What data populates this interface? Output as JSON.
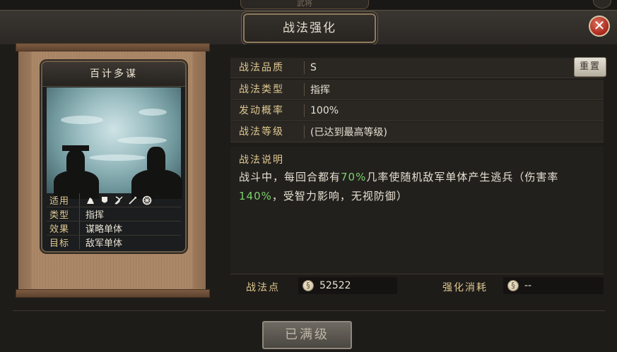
{
  "top_tab_label": "武将",
  "header": {
    "title": "战法强化",
    "close_icon": "close-icon"
  },
  "card": {
    "name": "百计多谋",
    "info": [
      {
        "key": "适用",
        "value": ""
      },
      {
        "key": "类型",
        "value": "指挥"
      },
      {
        "key": "效果",
        "value": "谋略单体"
      },
      {
        "key": "目标",
        "value": "敌军单体"
      }
    ],
    "suit_icons": [
      "cavalry-icon",
      "shield-icon",
      "bow-icon",
      "spear-icon",
      "wheel-icon"
    ]
  },
  "attributes": [
    {
      "key": "战法品质",
      "value": "S"
    },
    {
      "key": "战法类型",
      "value": "指挥"
    },
    {
      "key": "发动概率",
      "value": "100%"
    },
    {
      "key": "战法等级",
      "value": "(已达到最高等级)"
    }
  ],
  "reset_label": "重置",
  "description": {
    "title": "战法说明",
    "part1": "战斗中，每回合都有",
    "hl1": "70%",
    "part2": "几率使随机敌军单体产生逃兵（伤害率",
    "hl2": "140%",
    "part3": "，受智力影响，无视防御）"
  },
  "points": {
    "label": "战法点",
    "value": "52522",
    "cost_label": "强化消耗",
    "cost_value": "--"
  },
  "maxed_button": "已满级",
  "colors": {
    "highlight": "#7bd06c",
    "key_gold": "#e0c890",
    "close_red": "#a7261c"
  }
}
